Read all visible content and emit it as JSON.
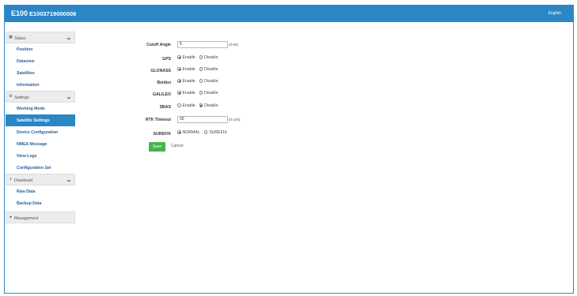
{
  "header": {
    "model": "E100",
    "serial": "E1003719000008",
    "language": "English"
  },
  "colors": {
    "header_bg": "#2b86c6",
    "active_item_bg": "#2b86c6",
    "save_button_bg": "#45b44f"
  },
  "sidebar": {
    "status": {
      "label": "Status",
      "icon": "chart-icon",
      "items": [
        "Position",
        "Dataview",
        "Satellites",
        "Information"
      ]
    },
    "settings": {
      "label": "Settings",
      "icon": "gear-icon",
      "items": [
        "Working Mode",
        "Satellite Settings",
        "Device Configuration",
        "NMEA Message",
        "View Logs",
        "Configuration Set"
      ],
      "active": "Satellite Settings"
    },
    "download": {
      "label": "Download",
      "icon": "download-icon",
      "items": [
        "Raw Data",
        "Backup Data"
      ]
    },
    "management": {
      "label": "Management",
      "icon": "info-icon"
    }
  },
  "form": {
    "cutoff": {
      "label": "Cutoff Angle",
      "value": "5",
      "hint": "(0-60)"
    },
    "gps": {
      "label": "GPS",
      "selected": "Enable"
    },
    "glonass": {
      "label": "GLONASS",
      "selected": "Enable"
    },
    "beidou": {
      "label": "Beidou",
      "selected": "Enable"
    },
    "galileo": {
      "label": "GALILEO",
      "selected": "Enable"
    },
    "sbas": {
      "label": "SBAS",
      "selected": "Disable"
    },
    "rtk_timeout": {
      "label": "RTK Timeout",
      "value": "30",
      "hint": "(0-100)"
    },
    "surefix": {
      "label": "SUREFIX",
      "options": [
        "NORMAL",
        "SUREFIX"
      ],
      "selected": "NORMAL"
    },
    "enable_label": "Enable",
    "disable_label": "Disable",
    "save_label": "Save",
    "cancel_label": "Cancel"
  }
}
